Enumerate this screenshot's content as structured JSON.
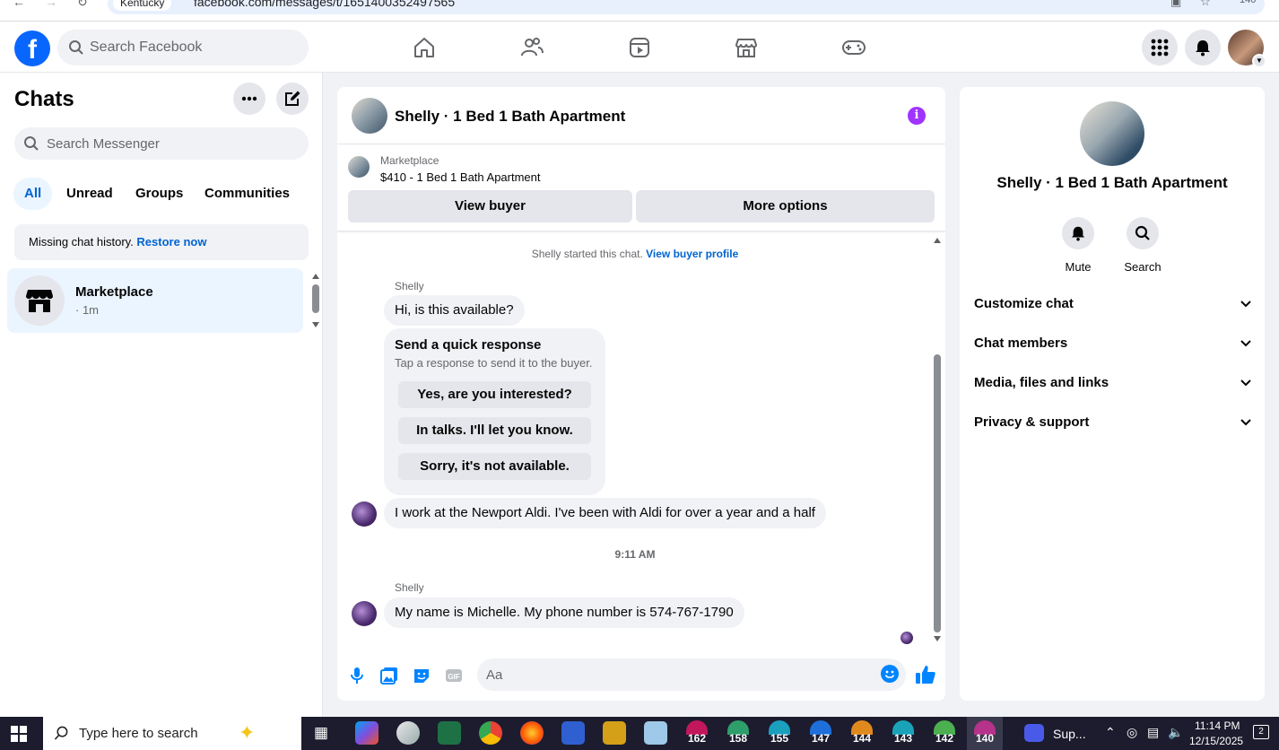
{
  "browser": {
    "site_chip": "Kentucky",
    "url": "facebook.com/messages/t/1651400352497565",
    "right_text": "140"
  },
  "topnav": {
    "search_placeholder": "Search Facebook",
    "tabs": [
      "home-icon",
      "friends-icon",
      "video-icon",
      "marketplace-icon",
      "gaming-icon"
    ],
    "buttons": [
      "menu-grid-icon",
      "notifications-icon"
    ],
    "brand_color": "#0866ff"
  },
  "sidebar": {
    "title": "Chats",
    "search_placeholder": "Search Messenger",
    "filters": [
      "All",
      "Unread",
      "Groups",
      "Communities"
    ],
    "active_filter": "All",
    "notice_text": "Missing chat history.",
    "notice_link": "Restore now",
    "chats": [
      {
        "name": "Marketplace",
        "time": "· 1m"
      }
    ]
  },
  "chat": {
    "title": "Shelly · 1 Bed 1 Bath Apartment",
    "marketplace_label": "Marketplace",
    "listing": "$410 - 1 Bed 1 Bath Apartment",
    "view_buyer": "View buyer",
    "more_options": "More options",
    "system_text": "Shelly started this chat.",
    "system_link": "View buyer profile",
    "messages": [
      {
        "sender": "Shelly",
        "text": "Hi, is this available?"
      },
      {
        "sender": "",
        "text": "I work at the Newport Aldi. I've been with Aldi for over a year and a half"
      },
      {
        "sender": "Shelly",
        "text": "My name is Michelle. My phone number is 574-767-1790"
      }
    ],
    "quick_response": {
      "title": "Send a quick response",
      "subtitle": "Tap a response to send it to the buyer.",
      "options": [
        "Yes, are you interested?",
        "In talks. I'll let you know.",
        "Sorry, it's not available."
      ]
    },
    "timestamp": "9:11 AM",
    "composer_placeholder": "Aa"
  },
  "details": {
    "name": "Shelly · 1 Bed 1 Bath Apartment",
    "actions": [
      "Mute",
      "Search"
    ],
    "sections": [
      "Customize chat",
      "Chat members",
      "Media, files and links",
      "Privacy & support"
    ]
  },
  "taskbar": {
    "search_placeholder": "Type here to search",
    "badges": [
      "162",
      "158",
      "155",
      "147",
      "144",
      "143",
      "142",
      "140"
    ],
    "app_label": "Sup...",
    "time": "11:14 PM",
    "date": "12/15/2025",
    "notif_count": "2"
  }
}
